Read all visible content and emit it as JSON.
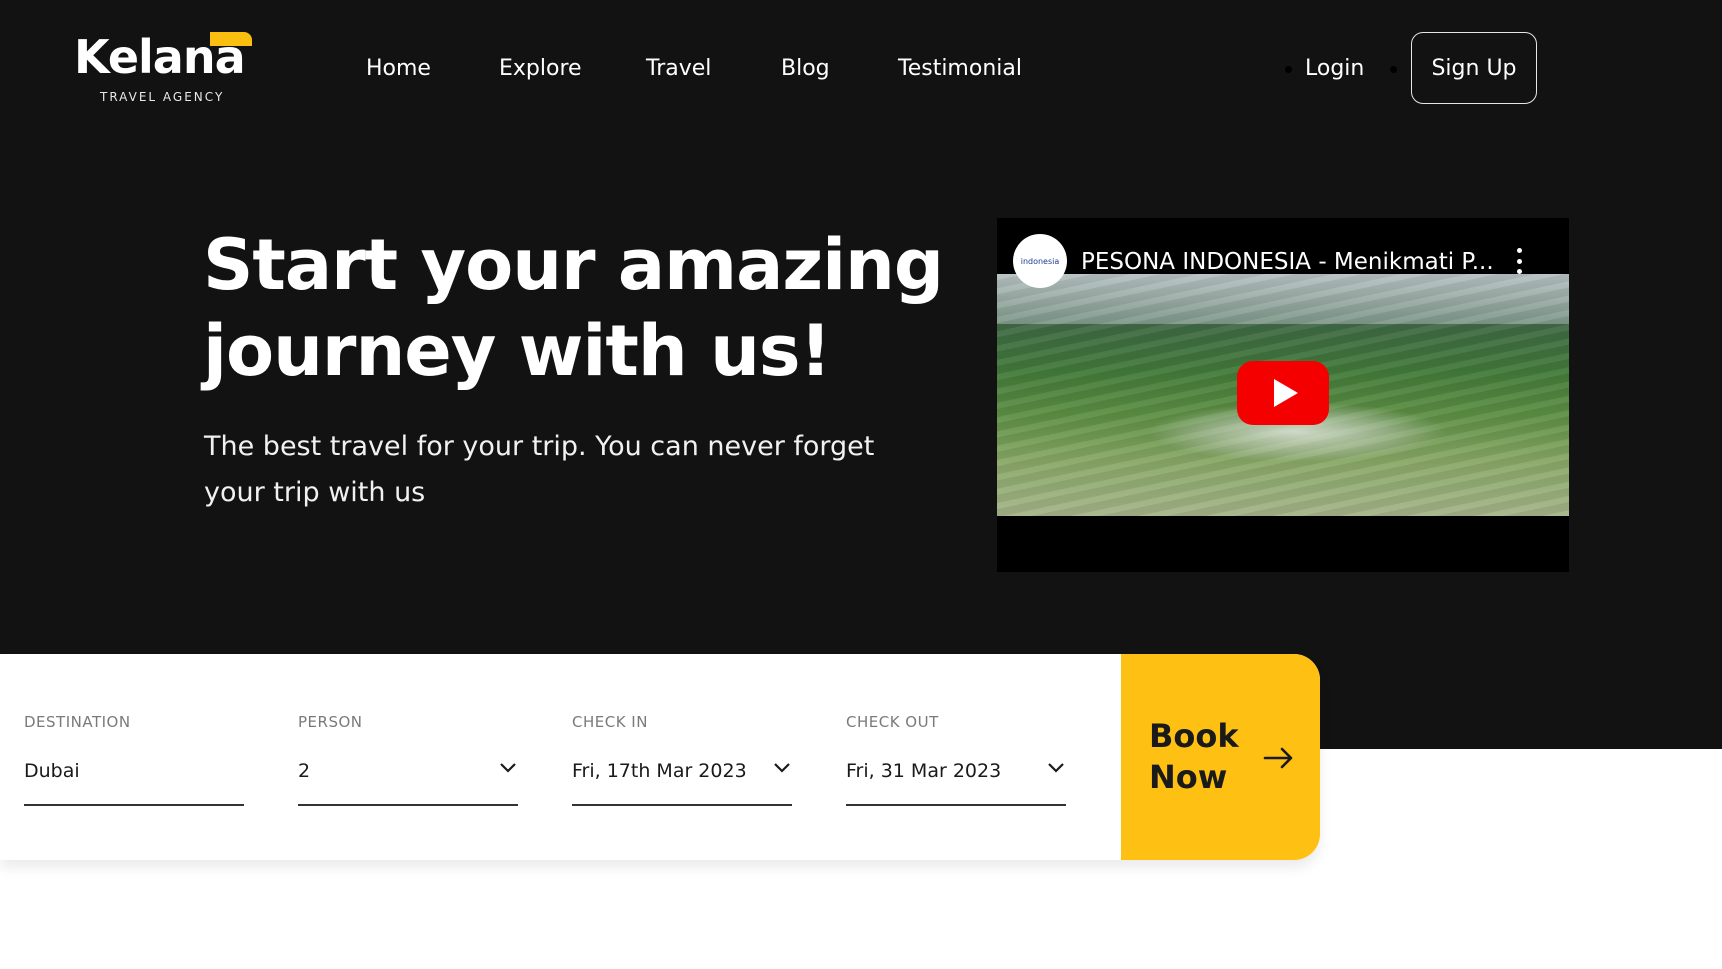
{
  "brand": {
    "name": "Kelana",
    "tagline": "TRAVEL AGENCY",
    "accent_color": "#fbbf10"
  },
  "nav": {
    "items": [
      {
        "label": "Home"
      },
      {
        "label": "Explore"
      },
      {
        "label": "Travel"
      },
      {
        "label": "Blog"
      },
      {
        "label": "Testimonial"
      }
    ],
    "login_label": "Login",
    "signup_label": "Sign Up"
  },
  "hero": {
    "headline_line1": "Start your amazing",
    "headline_line2": "journey with us!",
    "subcopy": "The best travel for your trip. You can never forget your trip with us"
  },
  "video": {
    "title": "PESONA INDONESIA - Menikmati P...",
    "channel_name": "indonesia",
    "play_icon": "play-icon",
    "play_color": "#f40000"
  },
  "booking": {
    "fields": [
      {
        "label": "DESTINATION",
        "value": "Dubai",
        "has_dropdown": false
      },
      {
        "label": "PERSON",
        "value": "2",
        "has_dropdown": true
      },
      {
        "label": "CHECK IN",
        "value": "Fri, 17th Mar 2023",
        "has_dropdown": true
      },
      {
        "label": "CHECK OUT",
        "value": "Fri, 31 Mar 2023",
        "has_dropdown": true
      }
    ],
    "book_line1": "Book",
    "book_line2": "Now",
    "book_color": "#fdc013",
    "book_icon": "arrow-right-icon"
  }
}
